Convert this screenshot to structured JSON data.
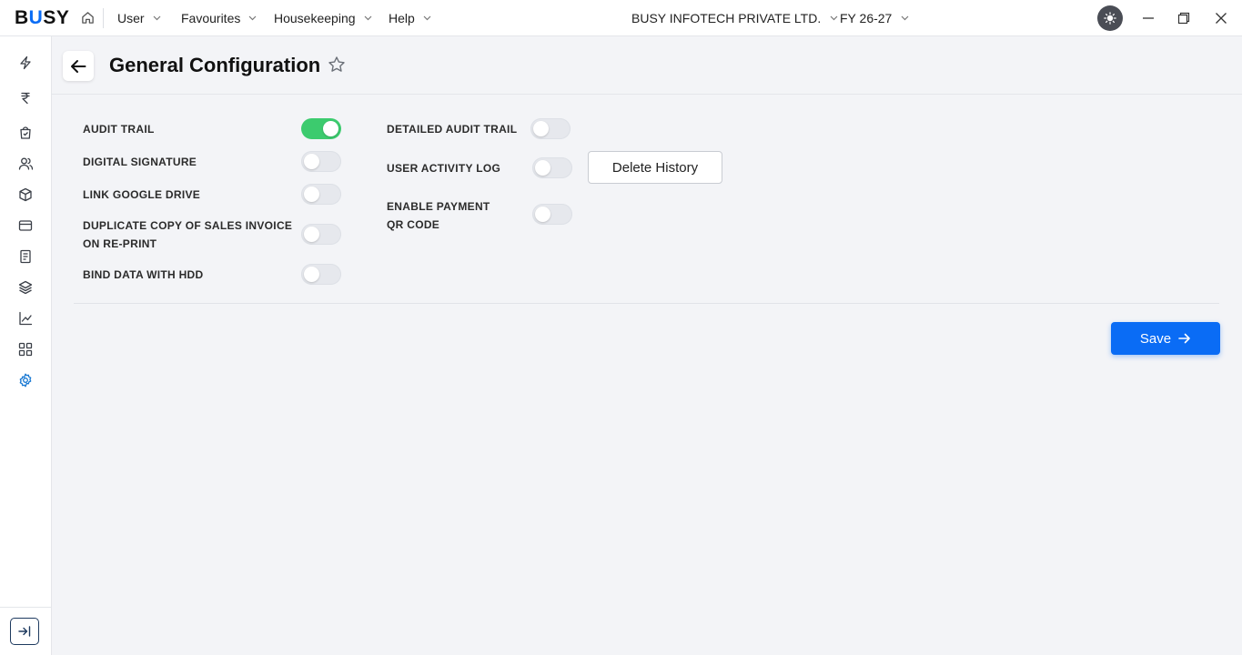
{
  "app": {
    "logo_prefix": "B",
    "logo_u": "U",
    "logo_suffix": "SY",
    "company": "BUSY INFOTECH PRIVATE LTD.",
    "fiscal_year": "FY 26-27"
  },
  "menu": {
    "user": "User",
    "favourites": "Favourites",
    "housekeeping": "Housekeeping",
    "help": "Help"
  },
  "icons": {
    "home": "home-icon",
    "theme": "sun-icon",
    "minimize": "minimize-icon",
    "restore": "restore-icon",
    "close": "close-icon",
    "back": "arrow-left-icon",
    "favourite": "star-icon",
    "sidebar": [
      "bolt-icon",
      "rupee-icon",
      "shopping-bag-icon",
      "users-icon",
      "box-icon",
      "card-icon",
      "document-icon",
      "layers-icon",
      "chart-line-icon",
      "grid-icon",
      "gear-icon"
    ],
    "collapse": "collapse-right-icon"
  },
  "colors": {
    "accent": "#0a6cf5",
    "toggle_on": "#3ccb6e",
    "active_nav": "#1677d2"
  },
  "page": {
    "title": "General Configuration"
  },
  "settings": {
    "left": [
      {
        "label": "AUDIT TRAIL",
        "enabled": true
      },
      {
        "label": "DIGITAL SIGNATURE",
        "enabled": false
      },
      {
        "label": "LINK GOOGLE DRIVE",
        "enabled": false
      },
      {
        "label_line1": "DUPLICATE COPY OF SALES INVOICE",
        "label_line2": "ON RE-PRINT",
        "enabled": false
      },
      {
        "label": "BIND DATA WITH HDD",
        "enabled": false
      }
    ],
    "right": [
      {
        "label": "DETAILED AUDIT TRAIL",
        "enabled": false
      },
      {
        "label": "USER ACTIVITY LOG",
        "enabled": false
      },
      {
        "label_line1": "ENABLE PAYMENT",
        "label_line2": "QR CODE",
        "enabled": false
      }
    ],
    "delete_history_label": "Delete History"
  },
  "actions": {
    "save_label": "Save"
  }
}
